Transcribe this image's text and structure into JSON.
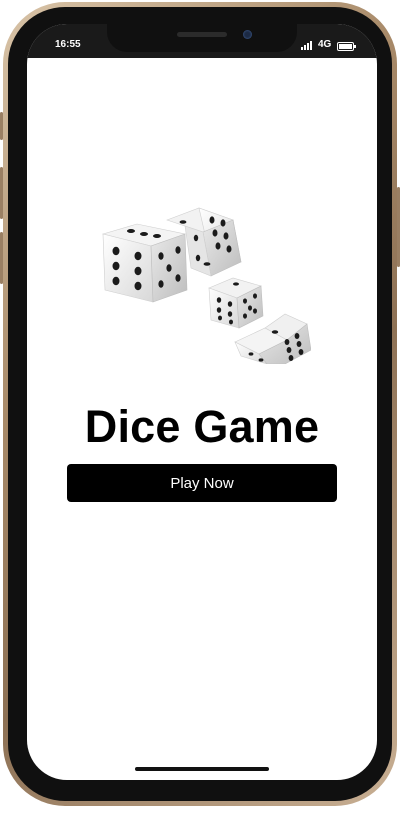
{
  "status_bar": {
    "time": "16:55",
    "network": "4G",
    "battery_level": 1.0
  },
  "main": {
    "title": "Dice Game",
    "play_button_label": "Play Now"
  },
  "icons": {
    "signal": "signal-bars-icon",
    "battery": "battery-icon",
    "dice": "dice-illustration"
  },
  "colors": {
    "background": "#ffffff",
    "button_background": "#000000",
    "button_text": "#ffffff",
    "title_text": "#000000",
    "phone_frame": "#a88a69"
  }
}
